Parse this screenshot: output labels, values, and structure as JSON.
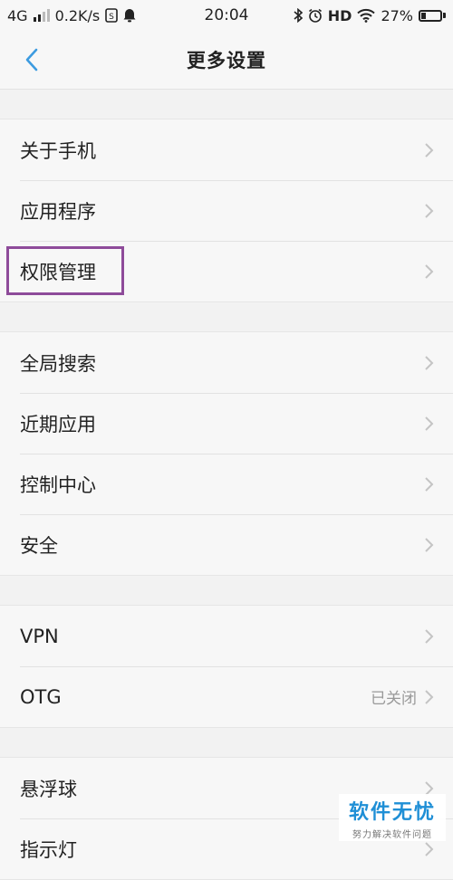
{
  "status_bar": {
    "network": "4G",
    "speed": "0.2K/s",
    "time": "20:04",
    "hd": "HD",
    "battery_percent": "27%",
    "battery_level": 0.27
  },
  "header": {
    "title": "更多设置"
  },
  "groups": [
    {
      "items": [
        {
          "label": "关于手机"
        },
        {
          "label": "应用程序"
        },
        {
          "label": "权限管理"
        }
      ]
    },
    {
      "items": [
        {
          "label": "全局搜索"
        },
        {
          "label": "近期应用"
        },
        {
          "label": "控制中心"
        },
        {
          "label": "安全"
        }
      ]
    },
    {
      "items": [
        {
          "label": "VPN"
        },
        {
          "label": "OTG",
          "value": "已关闭"
        }
      ]
    },
    {
      "items": [
        {
          "label": "悬浮球"
        },
        {
          "label": "指示灯"
        }
      ]
    }
  ],
  "watermark": {
    "main": "软件无忧",
    "sub": "努力解决软件问题"
  },
  "colors": {
    "accent_back": "#3c9be0",
    "highlight": "#8e4b9a"
  }
}
